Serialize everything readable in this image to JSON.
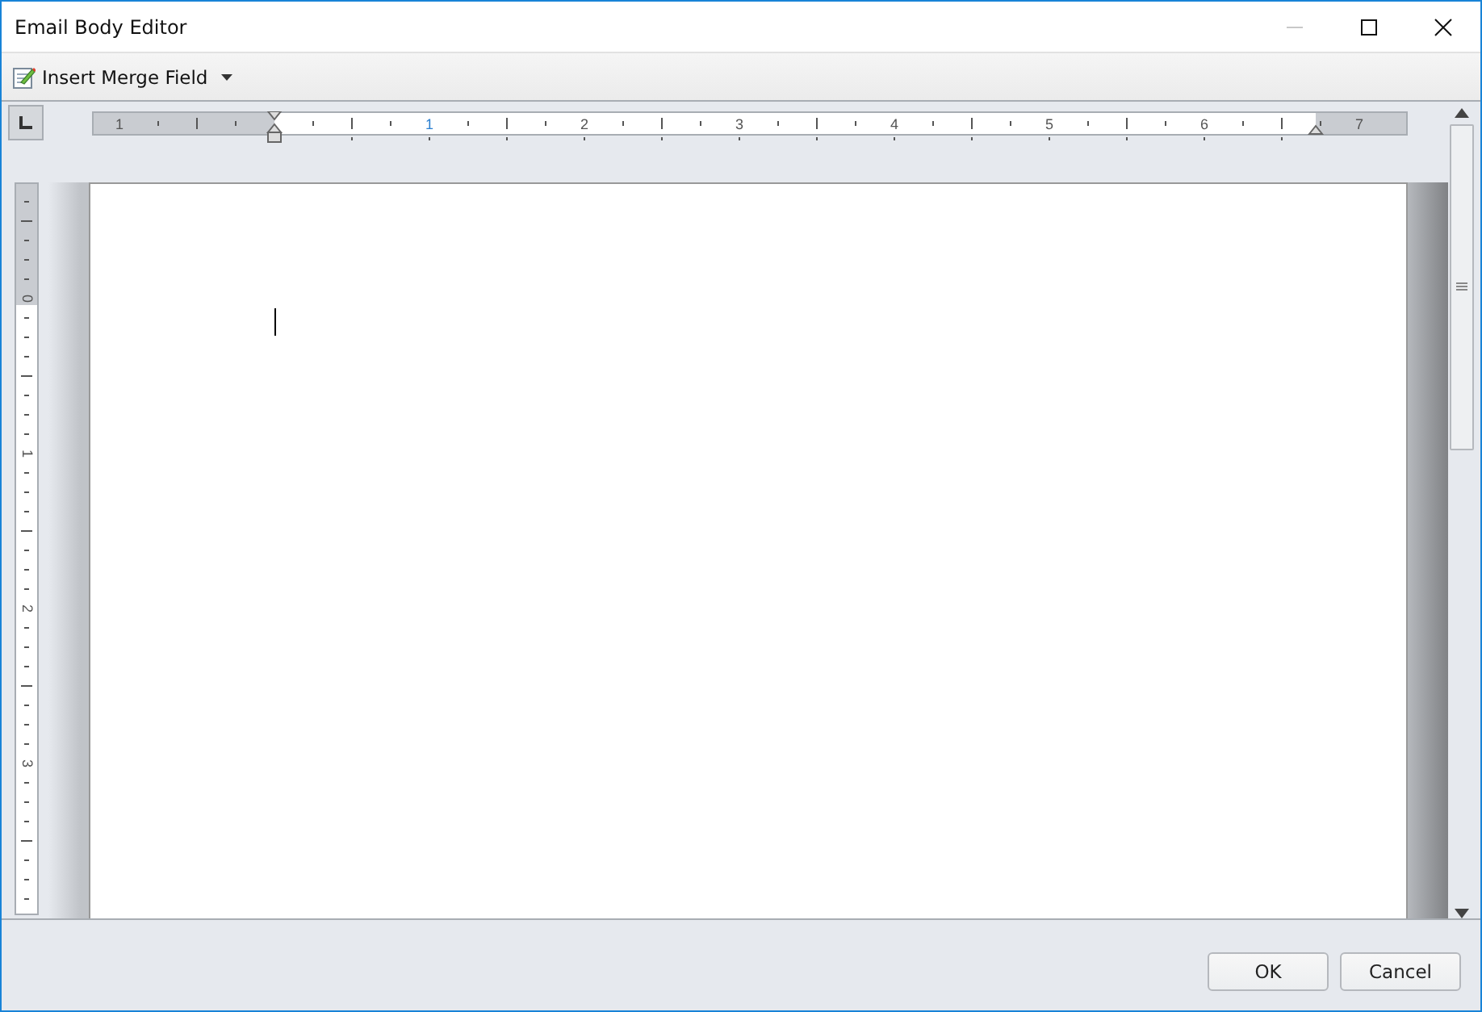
{
  "window": {
    "title": "Email Body Editor"
  },
  "toolbar": {
    "merge_field_button": {
      "label": "Insert Merge Field"
    }
  },
  "horizontal_ruler": {
    "labels": [
      "1",
      "1",
      "2",
      "3",
      "4",
      "5",
      "6",
      "7"
    ]
  },
  "vertical_ruler": {
    "labels": [
      "0",
      "1",
      "2",
      "3"
    ]
  },
  "buttons": [
    "OK",
    "Cancel"
  ]
}
